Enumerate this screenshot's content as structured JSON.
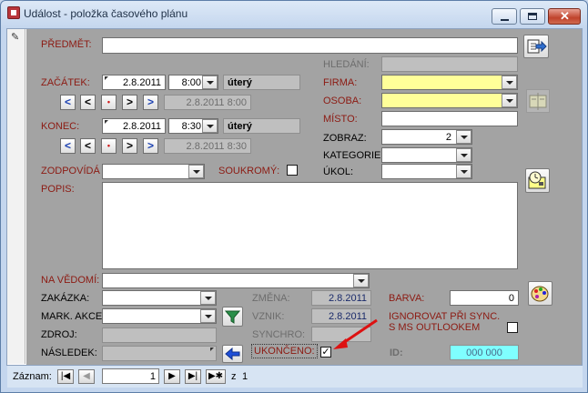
{
  "window": {
    "title": "Událost - položka časového plánu"
  },
  "labels": {
    "predmet": "PŘEDMĚT:",
    "hledani": "HLEDÁNÍ:",
    "zacatek": "ZAČÁTEK:",
    "konec": "KONEC:",
    "firma": "FIRMA:",
    "osoba": "OSOBA:",
    "misto": "MÍSTO:",
    "zobraz": "ZOBRAZ:",
    "kategorie": "KATEGORIE:",
    "ukol": "ÚKOL:",
    "zodpovida": "ZODPOVÍDÁ",
    "soukromy": "SOUKROMÝ:",
    "popis": "POPIS:",
    "na_vedomi": "NA VĚDOMÍ:",
    "zakazka": "ZAKÁZKA:",
    "mark_akce": "MARK. AKCE",
    "zdroj": "ZDROJ:",
    "nasledek": "NÁSLEDEK:",
    "zmena": "ZMĚNA:",
    "vznik": "VZNIK:",
    "synchro": "SYNCHRO:",
    "ukonceno": "UKONČENO:",
    "barva": "BARVA:",
    "ignorovat1": "IGNOROVAT PŘI SYNC.",
    "ignorovat2": "S MS OUTLOOKEM",
    "id": "ID:"
  },
  "values": {
    "zacatek_date": "2.8.2011",
    "zacatek_time": "8:00",
    "zacatek_day": "úterý",
    "zacatek_disp": "2.8.2011 8:00",
    "konec_date": "2.8.2011",
    "konec_time": "8:30",
    "konec_day": "úterý",
    "konec_disp": "2.8.2011 8:30",
    "zobraz": "2",
    "zmena": "2.8.2011",
    "vznik": "2.8.2011",
    "barva": "0",
    "id": "000 000"
  },
  "nav_buttons": {
    "first": "<",
    "prev": "<",
    "dot": "•",
    "next": ">",
    "last": ">"
  },
  "checks": {
    "ukonceno": "✓"
  },
  "record_nav": {
    "label": "Záznam:",
    "current": "1",
    "of": "z",
    "total": "1"
  },
  "colors": {
    "required_field": "#ffff99",
    "id_field": "#7fffff",
    "label_red": "#8c1a12"
  }
}
